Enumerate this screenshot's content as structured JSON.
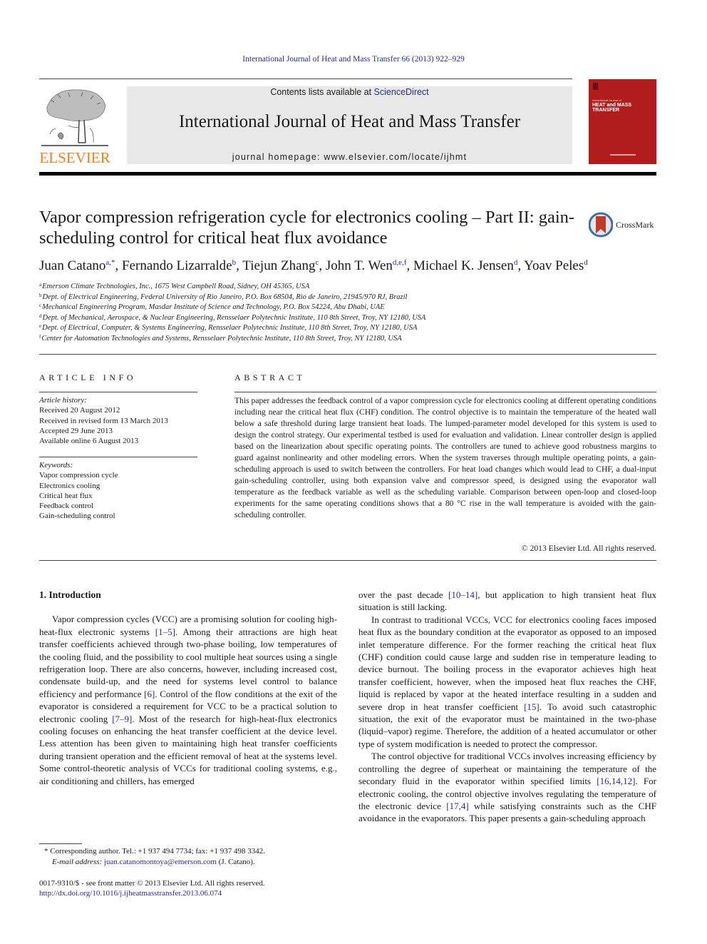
{
  "citation": "International Journal of Heat and Mass Transfer 66 (2013) 922–929",
  "header": {
    "contents_prefix": "Contents lists available at ",
    "contents_link": "ScienceDirect",
    "journal_name": "International Journal of Heat and Mass Transfer",
    "homepage": "journal homepage: www.elsevier.com/locate/ijhmt",
    "publisher_logo_text": "ELSEVIER",
    "cover": {
      "small_line": "International Journal of",
      "title": "HEAT and MASS\nTRANSFER"
    },
    "colors": {
      "elsevier_orange": "#f07f1e",
      "cover_red": "#b11c1c",
      "link_blue": "#2a2a8c"
    }
  },
  "article": {
    "title": "Vapor compression refrigeration cycle for electronics cooling – Part II: gain-scheduling control for critical heat flux avoidance",
    "crossmark_label": "CrossMark",
    "authors": [
      {
        "name": "Juan Catano",
        "sup": "a,*"
      },
      {
        "name": "Fernando Lizarralde",
        "sup": "b"
      },
      {
        "name": "Tiejun Zhang",
        "sup": "c"
      },
      {
        "name": "John T. Wen",
        "sup": "d,e,f"
      },
      {
        "name": "Michael K. Jensen",
        "sup": "d"
      },
      {
        "name": "Yoav Peles",
        "sup": "d"
      }
    ],
    "affiliations": [
      {
        "key": "a",
        "text": "Emerson Climate Technologies, Inc., 1675 West Campbell Road, Sidney, OH 45365, USA"
      },
      {
        "key": "b",
        "text": "Dept. of Electrical Engineering, Federal University of Rio Janeiro, P.O. Box 68504, Rio de Janeiro, 21945/970 RJ, Brazil"
      },
      {
        "key": "c",
        "text": "Mechanical Engineering Program, Masdar Institute of Science and Technology, P.O. Box 54224, Abu Dhabi, UAE"
      },
      {
        "key": "d",
        "text": "Dept. of Mechanical, Aerospace, & Nuclear Engineering, Rensselaer Polytechnic Institute, 110 8th Street, Troy, NY 12180, USA"
      },
      {
        "key": "e",
        "text": "Dept. of Electrical, Computer, & Systems Engineering, Rensselaer Polytechnic Institute, 110 8th Street, Troy, NY 12180, USA"
      },
      {
        "key": "f",
        "text": "Center for Automation Technologies and Systems, Rensselaer Polytechnic Institute, 110 8th Street, Troy, NY 12180, USA"
      }
    ]
  },
  "article_info": {
    "heading": "ARTICLE INFO",
    "history_label": "Article history:",
    "history": [
      "Received 20 August 2012",
      "Received in revised form 13 March 2013",
      "Accepted 29 June 2013",
      "Available online 6 August 2013"
    ],
    "keywords_label": "Keywords:",
    "keywords": [
      "Vapor compression cycle",
      "Electronics cooling",
      "Critical heat flux",
      "Feedback control",
      "Gain-scheduling control"
    ]
  },
  "abstract": {
    "heading": "ABSTRACT",
    "text": "This paper addresses the feedback control of a vapor compression cycle for electronics cooling at different operating conditions including near the critical heat flux (CHF) condition. The control objective is to maintain the temperature of the heated wall below a safe threshold during large transient heat loads. The lumped-parameter model developed for this system is used to design the control strategy. Our experimental testbed is used for evaluation and validation. Linear controller design is applied based on the linearization about specific operating points. The controllers are tuned to achieve good robustness margins to guard against nonlinearity and other modeling errors. When the system traverses through multiple operating points, a gain-scheduling approach is used to switch between the controllers. For heat load changes which would lead to CHF, a dual-input gain-scheduling controller, using both expansion valve and compressor speed, is designed using the evaporator wall temperature as the feedback variable as well as the scheduling variable. Comparison between open-loop and closed-loop experiments for the same operating conditions shows that a 80 °C rise in the wall temperature is avoided with the gain-scheduling controller.",
    "copyright": "© 2013 Elsevier Ltd. All rights reserved."
  },
  "body": {
    "section_heading": "1. Introduction",
    "left_paragraphs": [
      [
        {
          "t": "Vapor compression cycles (VCC) are a promising solution for cooling high-heat-flux electronic systems "
        },
        {
          "ref": "[1–5]"
        },
        {
          "t": ". Among their attractions are high heat transfer coefficients achieved through two-phase boiling, low temperatures of the cooling fluid, and the possibility to cool multiple heat sources using a single refrigeration loop. There are also concerns, however, including increased cost, condensate build-up, and the need for systems level control to balance efficiency and performance "
        },
        {
          "ref": "[6]"
        },
        {
          "t": ". Control of the flow conditions at the exit of the evaporator is considered a requirement for VCC to be a practical solution to electronic cooling "
        },
        {
          "ref": "[7–9]"
        },
        {
          "t": ". Most of the research for high-heat-flux electronics cooling focuses on enhancing the heat transfer coefficient at the device level. Less attention has been given to maintaining high heat transfer coefficients during transient operation and the efficient removal of heat at the systems level. Some control-theoretic analysis of VCCs for traditional cooling systems, e.g., air conditioning and chillers, has emerged"
        }
      ]
    ],
    "right_paragraphs": [
      [
        {
          "t": "over the past decade "
        },
        {
          "ref": "[10–14]"
        },
        {
          "t": ", but application to high transient heat flux situation is still lacking."
        }
      ],
      [
        {
          "t": "In contrast to traditional VCCs, VCC for electronics cooling faces imposed heat flux as the boundary condition at the evaporator as opposed to an imposed inlet temperature difference. For the former reaching the critical heat flux (CHF) condition could cause large and sudden rise in temperature leading to device burnout. The boiling process in the evaporator achieves high heat transfer coefficient, however, when the imposed heat flux reaches the CHF, liquid is replaced by vapor at the heated interface resulting in a sudden and severe drop in heat transfer coefficient "
        },
        {
          "ref": "[15]"
        },
        {
          "t": ". To avoid such catastrophic situation, the exit of the evaporator must be maintained in the two-phase (liquid–vapor) regime. Therefore, the addition of a heated accumulator or other type of system modification is needed to protect the compressor."
        }
      ],
      [
        {
          "t": "The control objective for traditional VCCs involves increasing efficiency by controlling the degree of superheat or maintaining the temperature of the secondary fluid in the evaporator within specified limits "
        },
        {
          "ref": "[16,14,12]"
        },
        {
          "t": ". For electronic cooling, the control objective involves regulating the temperature of the electronic device "
        },
        {
          "ref": "[17,4]"
        },
        {
          "t": " while satisfying constraints such as the CHF avoidance in the evaporators. This paper presents a gain-scheduling approach"
        }
      ]
    ]
  },
  "footnotes": {
    "corresponding": "* Corresponding author. Tel.: +1 937 494 7734; fax: +1 937 498 3342.",
    "email_label": "E-mail address: ",
    "email": "juan.catanomontoya@emerson.com",
    "email_suffix": " (J. Catano).",
    "front_matter": "0017-9310/$ - see front matter © 2013 Elsevier Ltd. All rights reserved.",
    "doi": "http://dx.doi.org/10.1016/j.ijheatmasstransfer.2013.06.074"
  }
}
